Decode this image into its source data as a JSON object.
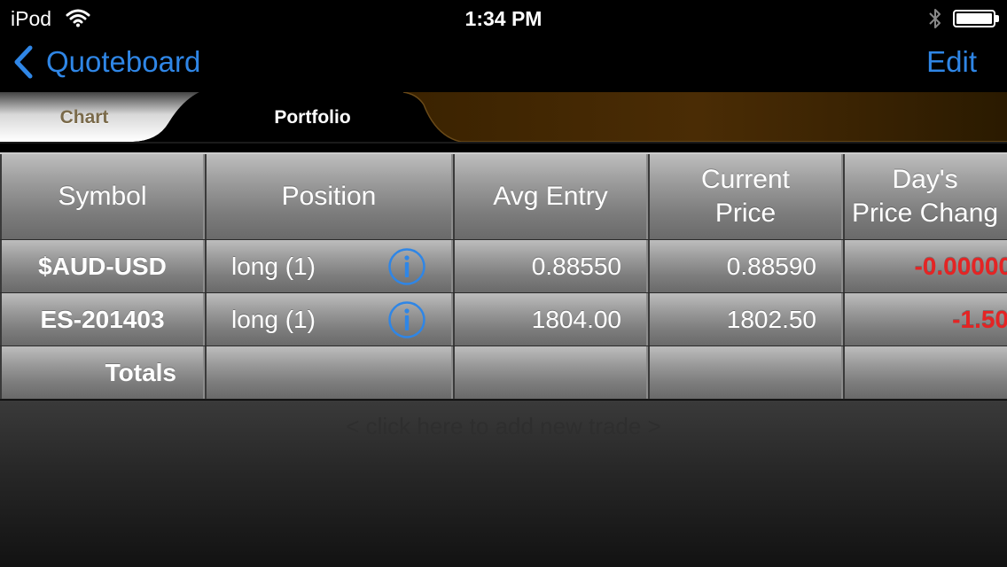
{
  "status_bar": {
    "carrier": "iPod",
    "time": "1:34 PM"
  },
  "nav": {
    "back_label": "Quoteboard",
    "edit_label": "Edit"
  },
  "tabs": [
    {
      "label": "Chart"
    },
    {
      "label": "Portfolio"
    }
  ],
  "table": {
    "headers": [
      "Symbol",
      "Position",
      "Avg Entry",
      "Current\nPrice",
      "Day's\nPrice Chang"
    ],
    "rows": [
      {
        "symbol": "$AUD-USD",
        "position": "long (1)",
        "avg_entry": "0.88550",
        "current_price": "0.88590",
        "day_change": "-0.00000"
      },
      {
        "symbol": "ES-201403",
        "position": "long (1)",
        "avg_entry": "1804.00",
        "current_price": "1802.50",
        "day_change": "-1.50"
      }
    ],
    "totals_label": "Totals"
  },
  "add_trade_label": "< click here to add new trade >",
  "colors": {
    "accent": "#2f86e6",
    "negative": "#e52424",
    "tab_gold": "#7a5a20"
  },
  "icons": {
    "back": "chevron-left-icon",
    "info": "info-circle-icon",
    "wifi": "wifi-icon",
    "bluetooth": "bluetooth-icon",
    "battery": "battery-icon"
  }
}
